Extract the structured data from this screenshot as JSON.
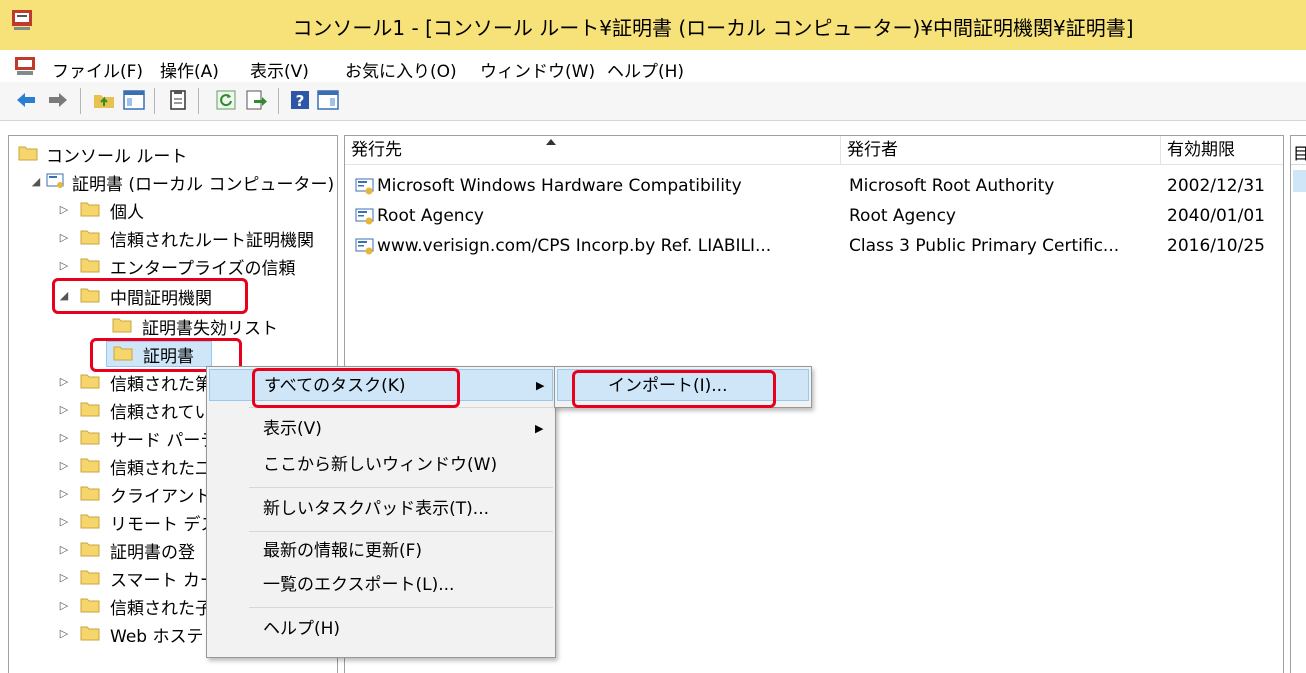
{
  "window": {
    "title": "コンソール1 - [コンソール ルート¥証明書 (ローカル コンピューター)¥中間証明機関¥証明書]"
  },
  "menubar": {
    "items": [
      {
        "label": "ファイル(F)"
      },
      {
        "label": "操作(A)"
      },
      {
        "label": "表示(V)"
      },
      {
        "label": "お気に入り(O)"
      },
      {
        "label": "ウィンドウ(W)"
      },
      {
        "label": "ヘルプ(H)"
      }
    ]
  },
  "toolbar": {
    "icons": [
      "back-icon",
      "forward-icon",
      "up-folder-icon",
      "show-hide-tree-icon",
      "properties-icon",
      "refresh-icon",
      "export-list-icon",
      "help-icon",
      "show-hide-action-pane-icon"
    ]
  },
  "tree": {
    "items": [
      {
        "label": "コンソール ルート"
      },
      {
        "label": "証明書 (ローカル コンピューター)"
      },
      {
        "label": "個人"
      },
      {
        "label": "信頼されたルート証明機関"
      },
      {
        "label": "エンタープライズの信頼"
      },
      {
        "label": "中間証明機関"
      },
      {
        "label": "証明書失効リスト"
      },
      {
        "label": "証明書"
      },
      {
        "label": "信頼された第"
      },
      {
        "label": "信頼されてい"
      },
      {
        "label": "サード パーテ"
      },
      {
        "label": "信頼された二"
      },
      {
        "label": "クライアント認"
      },
      {
        "label": "リモート デス"
      },
      {
        "label": "証明書の登"
      },
      {
        "label": "スマート カー"
      },
      {
        "label": "信頼された子"
      },
      {
        "label": "Web ホステ"
      }
    ]
  },
  "list": {
    "columns": [
      {
        "label": "発行先"
      },
      {
        "label": "発行者"
      },
      {
        "label": "有効期限"
      },
      {
        "label": "目"
      }
    ],
    "rows": [
      {
        "issued_to": "Microsoft Windows Hardware Compatibility",
        "issued_by": "Microsoft Root Authority",
        "expires": "2002/12/31"
      },
      {
        "issued_to": "Root Agency",
        "issued_by": "Root Agency",
        "expires": "2040/01/01"
      },
      {
        "issued_to": "www.verisign.com/CPS Incorp.by Ref. LIABILI...",
        "issued_by": "Class 3 Public Primary Certific...",
        "expires": "2016/10/25"
      }
    ]
  },
  "context_menu": {
    "items": [
      {
        "label": "すべてのタスク(K)",
        "submenu": true
      },
      {
        "label": "表示(V)",
        "submenu": true
      },
      {
        "label": "ここから新しいウィンドウ(W)"
      },
      {
        "label": "新しいタスクパッド表示(T)..."
      },
      {
        "label": "最新の情報に更新(F)"
      },
      {
        "label": "一覧のエクスポート(L)..."
      },
      {
        "label": "ヘルプ(H)"
      }
    ]
  },
  "submenu": {
    "items": [
      {
        "label": "インポート(I)..."
      }
    ]
  },
  "colors": {
    "titlebar": "#f7e27a",
    "highlight_red": "#e8001c",
    "menu_hover": "#cfe6f8",
    "folder_yellow": "#f6d66c"
  }
}
